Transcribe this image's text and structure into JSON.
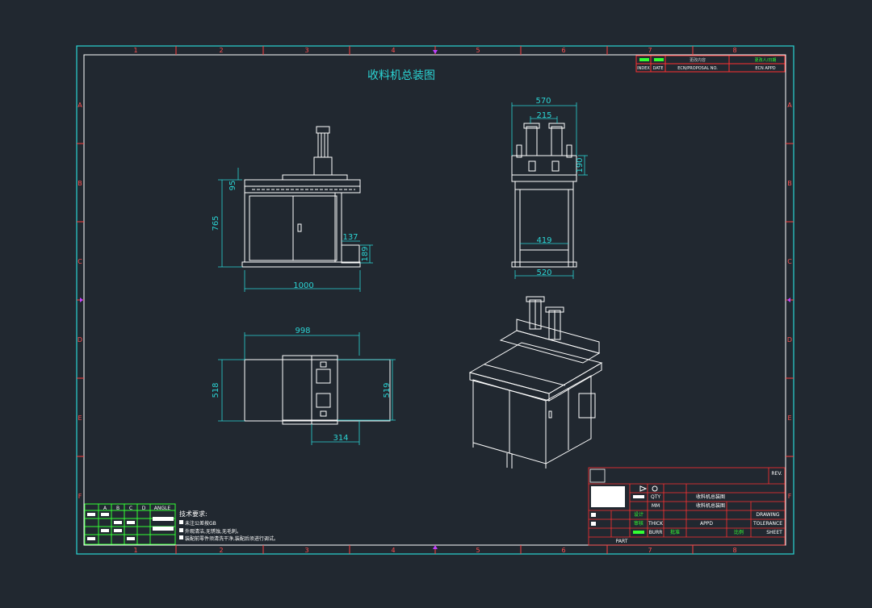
{
  "title": "收料机总装图",
  "border": {
    "top_numbers": [
      "1",
      "2",
      "3",
      "4",
      "5",
      "6",
      "7",
      "8"
    ],
    "side_letters": [
      "A",
      "B",
      "C",
      "D",
      "E",
      "F"
    ]
  },
  "revision_block": {
    "header1": "更改内容",
    "header2": "更改人/日期",
    "row_index": "INDEX",
    "row_date": "DATE",
    "row_rev": "ECN/PROPOSAL NO.",
    "row_app": "ECN APPD"
  },
  "front_view": {
    "width": "1000",
    "height": "765",
    "top_offset": "95",
    "side_w": "137",
    "side_h": "189"
  },
  "side_view": {
    "top_width": "570",
    "cyl_spacing": "215",
    "cyl_height": "190",
    "inner_width": "419",
    "base_width": "520"
  },
  "top_view": {
    "length": "998",
    "left_height": "518",
    "right_height": "519",
    "block_width": "314"
  },
  "tech_notes": {
    "heading": "技术要求:",
    "lines": [
      "未注公差按GB",
      "外观清洁,无锈蚀,无毛刺。",
      "装配前零件须清洗干净,装配后须进行调试。"
    ]
  },
  "angle_table": {
    "col_headers": [
      "A",
      "B",
      "C",
      "D",
      "ANGLE"
    ]
  },
  "title_block": {
    "drawing_name": "收料机总装图",
    "drawing_no": "收料机总装图",
    "designer_label": "设计",
    "checker_label": "审核",
    "approve_label": "批准",
    "drawing_label": "DRAWING",
    "tolerance_label": "TOLERANCE",
    "sheet_label": "SHEET",
    "scale_label": "比例",
    "qty_label": "QTY",
    "unit_label": "MM",
    "thick_label": "THICK",
    "burr_label": "BURR",
    "part_label": "PART",
    "appd_label": "APPD",
    "rev_label": "REV."
  }
}
